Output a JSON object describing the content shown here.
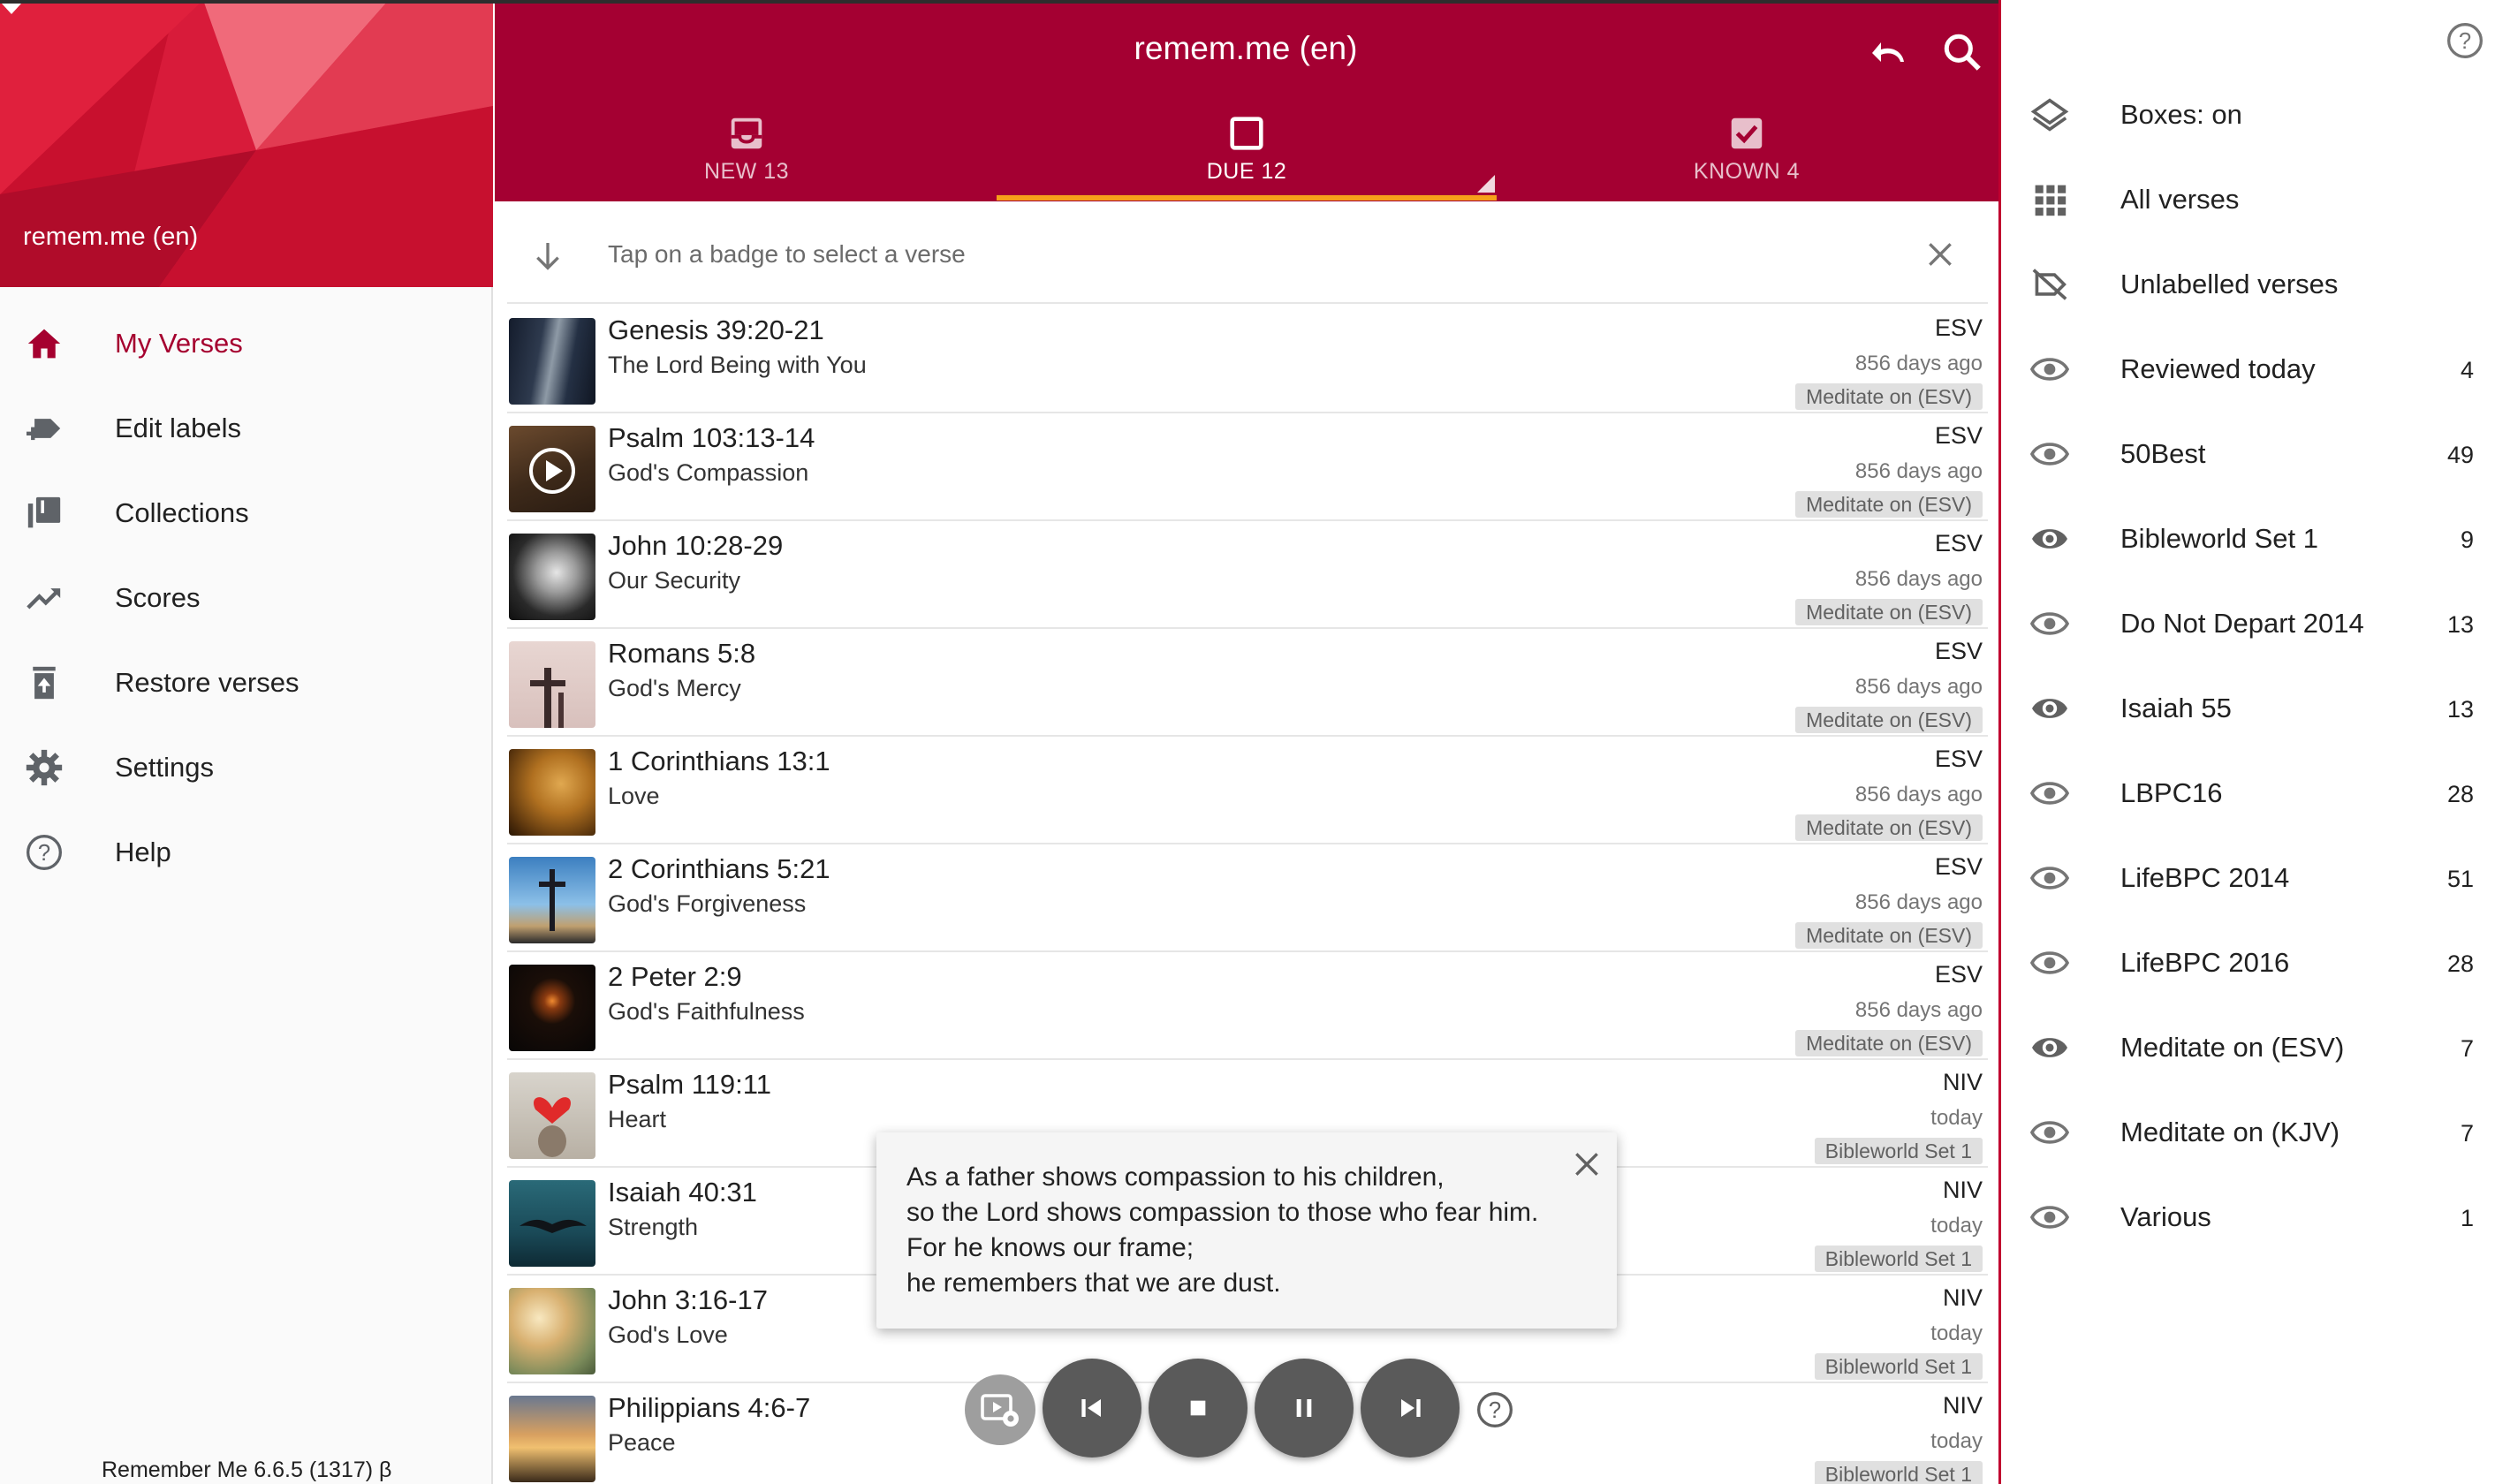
{
  "app": {
    "title": "remem.me (en)",
    "version": "Remember Me 6.6.5 (1317) β",
    "account_name": "remem.me (en)"
  },
  "colors": {
    "primary": "#a40032",
    "accent": "#f7a11a",
    "right_panel_border": "#c0002f"
  },
  "drawer": {
    "items": [
      {
        "label": "My Verses",
        "icon": "home-icon",
        "active": true
      },
      {
        "label": "Edit labels",
        "icon": "label-edit-icon"
      },
      {
        "label": "Collections",
        "icon": "collections-icon"
      },
      {
        "label": "Scores",
        "icon": "trending-up-icon"
      },
      {
        "label": "Restore verses",
        "icon": "restore-bin-icon"
      },
      {
        "label": "Settings",
        "icon": "gear-icon"
      },
      {
        "label": "Help",
        "icon": "help-icon"
      }
    ]
  },
  "tabs": [
    {
      "label": "NEW 13",
      "icon": "inbox-icon"
    },
    {
      "label": "DUE 12",
      "icon": "checkbox-empty-icon",
      "active": true
    },
    {
      "label": "KNOWN 4",
      "icon": "checkbox-checked-icon"
    }
  ],
  "hint": {
    "text": "Tap on a badge to select a verse"
  },
  "verses": [
    {
      "ref": "Genesis 39:20-21",
      "title": "The Lord Being with You",
      "translation": "ESV",
      "ago": "856 days ago",
      "badge": "Meditate on (ESV)"
    },
    {
      "ref": "Psalm 103:13-14",
      "title": "God's Compassion",
      "translation": "ESV",
      "ago": "856 days ago",
      "badge": "Meditate on (ESV)"
    },
    {
      "ref": "John 10:28-29",
      "title": "Our Security",
      "translation": "ESV",
      "ago": "856 days ago",
      "badge": "Meditate on (ESV)"
    },
    {
      "ref": "Romans 5:8",
      "title": "God's Mercy",
      "translation": "ESV",
      "ago": "856 days ago",
      "badge": "Meditate on (ESV)"
    },
    {
      "ref": "1 Corinthians 13:1",
      "title": "Love",
      "translation": "ESV",
      "ago": "856 days ago",
      "badge": "Meditate on (ESV)"
    },
    {
      "ref": "2 Corinthians 5:21",
      "title": "God's Forgiveness",
      "translation": "ESV",
      "ago": "856 days ago",
      "badge": "Meditate on (ESV)"
    },
    {
      "ref": "2 Peter 2:9",
      "title": "God's Faithfulness",
      "translation": "ESV",
      "ago": "856 days ago",
      "badge": "Meditate on (ESV)"
    },
    {
      "ref": "Psalm 119:11",
      "title": "Heart",
      "translation": "NIV",
      "ago": "today",
      "badge": "Bibleworld Set 1"
    },
    {
      "ref": "Isaiah 40:31",
      "title": "Strength",
      "translation": "NIV",
      "ago": "today",
      "badge": "Bibleworld Set 1"
    },
    {
      "ref": "John 3:16-17",
      "title": "God's Love",
      "translation": "NIV",
      "ago": "today",
      "badge": "Bibleworld Set 1"
    },
    {
      "ref": "Philippians 4:6-7",
      "title": "Peace",
      "translation": "NIV",
      "ago": "today",
      "badge": "Bibleworld Set 1"
    }
  ],
  "popup": {
    "lines": [
      "As a father shows compassion to his children,",
      "so the Lord shows compassion to those who fear him.",
      "For he knows our frame;",
      "he remembers that we are dust."
    ]
  },
  "player": {
    "controls": [
      "player-settings-icon",
      "skip-previous-icon",
      "stop-icon",
      "pause-icon",
      "skip-next-icon",
      "help-icon"
    ]
  },
  "labels_panel": {
    "items": [
      {
        "label": "Boxes: on",
        "icon": "layers-icon",
        "count": ""
      },
      {
        "label": "All verses",
        "icon": "grid-icon",
        "count": ""
      },
      {
        "label": "Unlabelled verses",
        "icon": "label-off-icon",
        "count": ""
      },
      {
        "label": "Reviewed today",
        "icon": "eye-icon",
        "count": "4"
      },
      {
        "label": "50Best",
        "icon": "eye-icon",
        "count": "49"
      },
      {
        "label": "Bibleworld Set 1",
        "icon": "eye-filled-icon",
        "count": "9"
      },
      {
        "label": "Do Not Depart 2014",
        "icon": "eye-icon",
        "count": "13"
      },
      {
        "label": "Isaiah 55",
        "icon": "eye-filled-icon",
        "count": "13"
      },
      {
        "label": "LBPC16",
        "icon": "eye-icon",
        "count": "28"
      },
      {
        "label": "LifeBPC 2014",
        "icon": "eye-icon",
        "count": "51"
      },
      {
        "label": "LifeBPC 2016",
        "icon": "eye-icon",
        "count": "28"
      },
      {
        "label": "Meditate on (ESV)",
        "icon": "eye-filled-icon",
        "count": "7"
      },
      {
        "label": "Meditate on (KJV)",
        "icon": "eye-icon",
        "count": "7"
      },
      {
        "label": "Various",
        "icon": "eye-icon",
        "count": "1"
      }
    ]
  }
}
